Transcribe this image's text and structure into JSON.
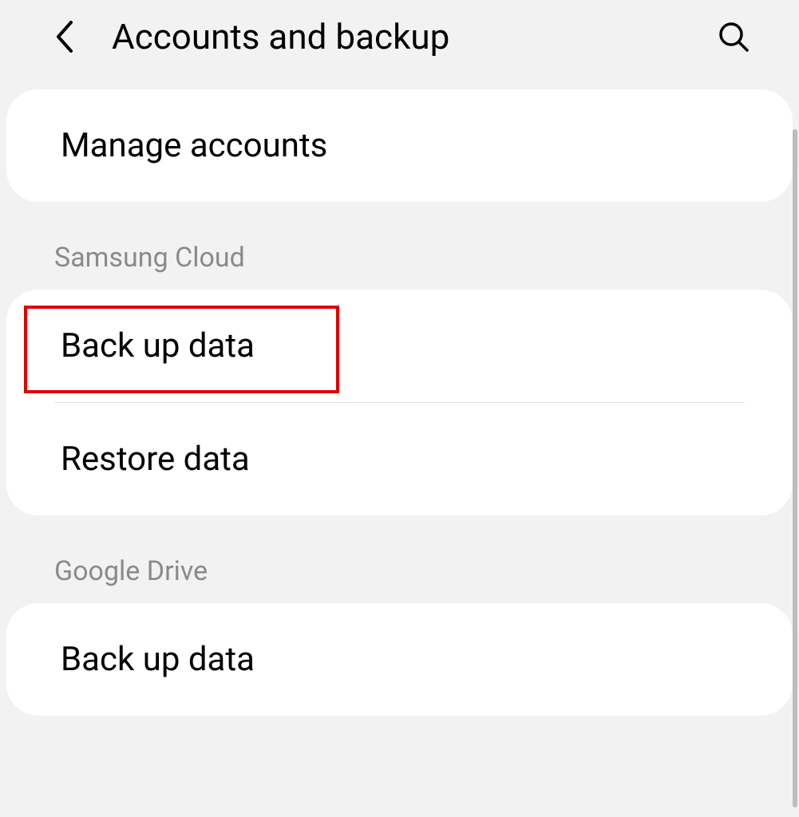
{
  "header": {
    "title": "Accounts and backup"
  },
  "sections": [
    {
      "items": [
        {
          "label": "Manage accounts"
        }
      ]
    },
    {
      "title": "Samsung Cloud",
      "items": [
        {
          "label": "Back up data",
          "highlighted": true
        },
        {
          "label": "Restore data"
        }
      ]
    },
    {
      "title": "Google Drive",
      "items": [
        {
          "label": "Back up data"
        }
      ]
    }
  ]
}
